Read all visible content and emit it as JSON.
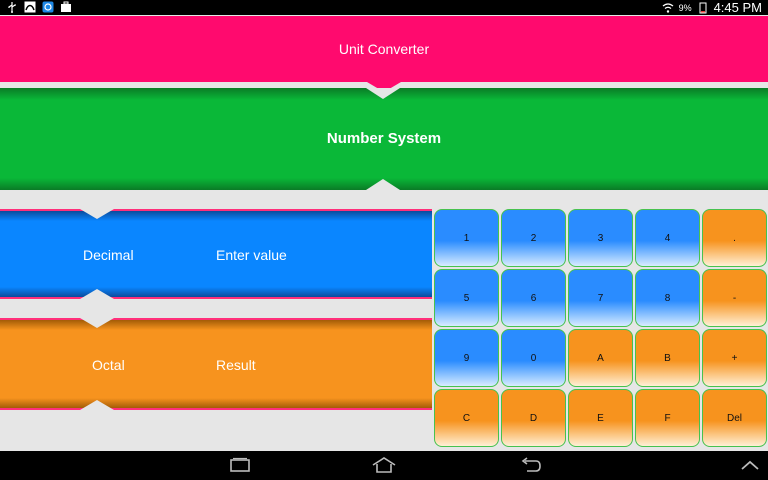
{
  "status_bar": {
    "battery_percent": "9%",
    "time": "4:45 PM"
  },
  "header": {
    "title": "Unit Converter"
  },
  "section": {
    "title": "Number System"
  },
  "input_panel": {
    "label": "Decimal",
    "value_placeholder": "Enter value"
  },
  "output_panel": {
    "label": "Octal",
    "value_placeholder": "Result"
  },
  "keypad": {
    "keys": [
      {
        "label": "1",
        "style": "blue"
      },
      {
        "label": "2",
        "style": "blue"
      },
      {
        "label": "3",
        "style": "blue"
      },
      {
        "label": "4",
        "style": "blue"
      },
      {
        "label": ".",
        "style": "orange"
      },
      {
        "label": "5",
        "style": "blue"
      },
      {
        "label": "6",
        "style": "blue"
      },
      {
        "label": "7",
        "style": "blue"
      },
      {
        "label": "8",
        "style": "blue"
      },
      {
        "label": "-",
        "style": "orange"
      },
      {
        "label": "9",
        "style": "blue"
      },
      {
        "label": "0",
        "style": "blue"
      },
      {
        "label": "A",
        "style": "orange"
      },
      {
        "label": "B",
        "style": "orange"
      },
      {
        "label": "+",
        "style": "orange"
      },
      {
        "label": "C",
        "style": "orange"
      },
      {
        "label": "D",
        "style": "orange"
      },
      {
        "label": "E",
        "style": "orange"
      },
      {
        "label": "F",
        "style": "orange"
      },
      {
        "label": "Del",
        "style": "orange"
      }
    ]
  },
  "colors": {
    "header_pink": "#ff0a6e",
    "section_green": "#0ab838",
    "panel_blue": "#0a86ff",
    "panel_orange": "#f7931e",
    "key_border": "#47c24f"
  },
  "nav_icons": [
    "recent-apps-icon",
    "home-icon",
    "back-icon",
    "chevron-up-icon"
  ]
}
